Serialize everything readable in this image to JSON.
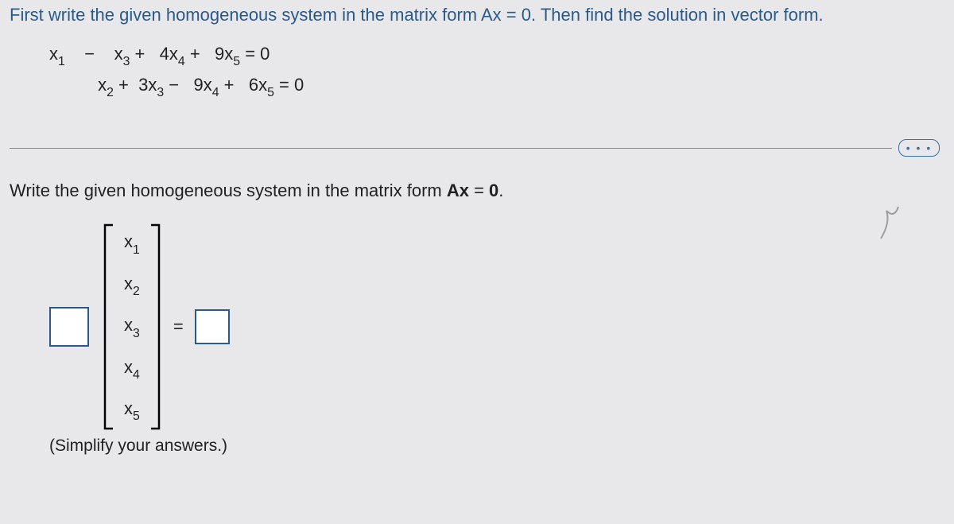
{
  "instruction": "First write the given homogeneous system in the matrix form Ax = 0. Then find the solution in vector form.",
  "equations": {
    "row1": {
      "x1": "x",
      "s1": "1",
      "sep1": "    −    ",
      "x3": "x",
      "s3": "3",
      "plus1": " +   4",
      "x4": "x",
      "s4": "4",
      "plus2": " +   9",
      "x5": "x",
      "s5": "5",
      "eq": " = 0"
    },
    "row2": {
      "lead": "          ",
      "x2": "x",
      "s2": "2",
      "plus0": " +  3",
      "x3": "x",
      "s3": "3",
      "minus": " −   9",
      "x4": "x",
      "s4": "4",
      "plus2": " +   6",
      "x5": "x",
      "s5": "5",
      "eq": " = 0"
    }
  },
  "dots": "• • •",
  "sub_instruction_pre": "Write the given homogeneous system in the matrix form ",
  "sub_instruction_ax": "Ax",
  "sub_instruction_post": " = ",
  "sub_instruction_zero": "0",
  "sub_instruction_end": ".",
  "vector": {
    "v1": "x",
    "s1": "1",
    "v2": "x",
    "s2": "2",
    "v3": "x",
    "s3": "3",
    "v4": "x",
    "s4": "4",
    "v5": "x",
    "s5": "5"
  },
  "eqsign": "=",
  "simplify": "(Simplify your answers.)"
}
